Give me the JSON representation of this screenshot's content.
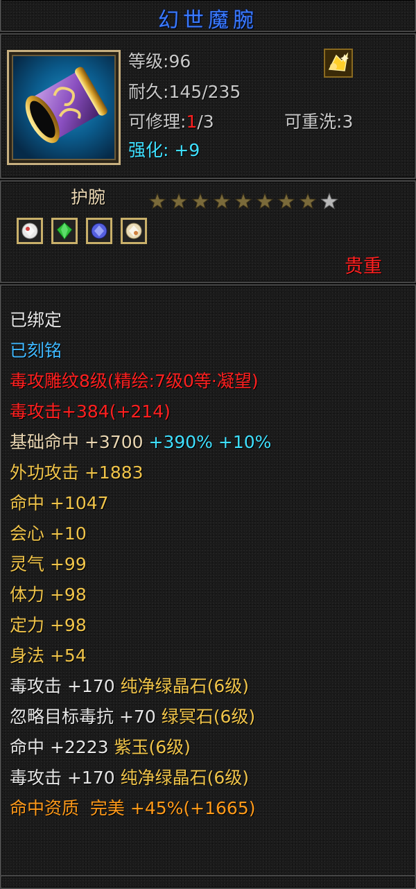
{
  "item": {
    "name": "幻世魔腕",
    "level_label": "等级",
    "level_value": "96",
    "durability_label": "耐久",
    "durability_value": "145/235",
    "repair_label": "可修理",
    "repair_current": "1",
    "repair_max": "/3",
    "rewash_label": "可重洗",
    "rewash_value": "3",
    "enhance_label": "强化:",
    "enhance_value": "+9",
    "type": "护腕",
    "stars_filled": 8,
    "stars_total": 9,
    "rarity": "贵重",
    "icon": "bracer-icon",
    "badge_icon": "gold-gem-badge-icon",
    "colors": {
      "title": "#3b7bff",
      "red": "#ff2020",
      "cyan": "#3fe0ff",
      "gold": "#f0c44a",
      "orange": "#ff9a1a"
    }
  },
  "gems": [
    {
      "name": "white-gem-icon",
      "color": "#e8e8e8"
    },
    {
      "name": "green-gem-icon",
      "color": "#2fbf3a"
    },
    {
      "name": "blue-gem-icon",
      "color": "#6f7bff"
    },
    {
      "name": "white-gem-icon",
      "color": "#eadcb8"
    }
  ],
  "status": {
    "bound": "已绑定",
    "engraved": "已刻铭"
  },
  "engraving": "毒攻雕纹8级(精绘:7级0等·凝望)",
  "poison_attack": {
    "label": "毒攻击",
    "value": "+384",
    "bonus": "(+214)"
  },
  "base_hit": {
    "label": "基础命中",
    "value": "+3700",
    "pct1": "+390%",
    "pct2": "+10%"
  },
  "attributes": [
    {
      "label": "外功攻击",
      "value": "+1883"
    },
    {
      "label": "命中",
      "value": "+1047"
    },
    {
      "label": "会心",
      "value": "+10"
    },
    {
      "label": "灵气",
      "value": "+99"
    },
    {
      "label": "体力",
      "value": "+98"
    },
    {
      "label": "定力",
      "value": "+98"
    },
    {
      "label": "身法",
      "value": "+54"
    }
  ],
  "gem_effects": [
    {
      "label": "毒攻击",
      "value": "+170",
      "gem": "纯净绿晶石(6级)"
    },
    {
      "label": "忽略目标毒抗",
      "value": "+70",
      "gem": "绿冥石(6级)"
    },
    {
      "label": "命中",
      "value": "+2223",
      "gem": "紫玉(6级)"
    },
    {
      "label": "毒攻击",
      "value": "+170",
      "gem": "纯净绿晶石(6级)"
    }
  ],
  "aptitude": {
    "label": "命中资质",
    "grade": "完美",
    "pct": "+45%",
    "bonus": "(+1665)"
  }
}
